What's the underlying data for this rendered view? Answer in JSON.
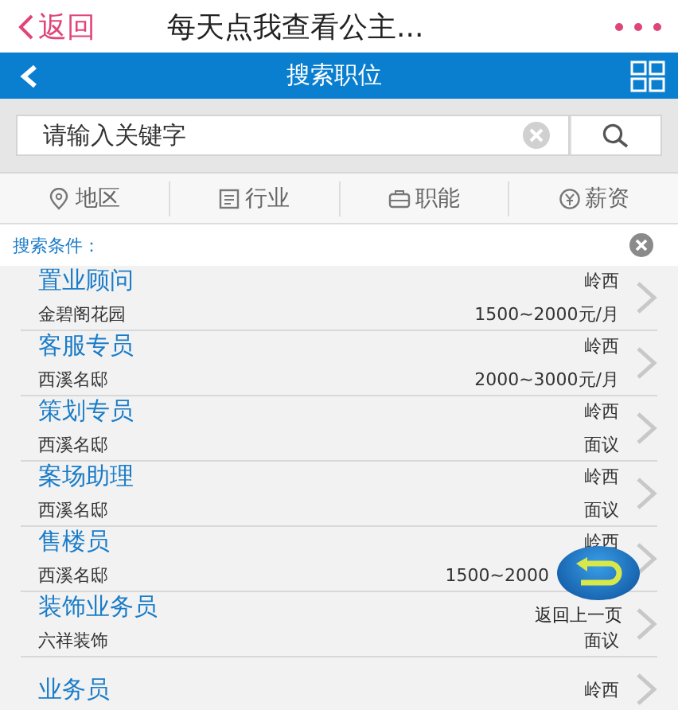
{
  "top_bar": {
    "back": "返回",
    "title": "每天点我查看公主..."
  },
  "nav_bar": {
    "title": "搜索职位"
  },
  "search": {
    "placeholder": "请输入关键字"
  },
  "filters": [
    {
      "label": "地区",
      "kind": "pin"
    },
    {
      "label": "行业",
      "kind": "doc"
    },
    {
      "label": "职能",
      "kind": "bag"
    },
    {
      "label": "薪资",
      "kind": "yen"
    }
  ],
  "conditions": {
    "label": "搜索条件："
  },
  "jobs": [
    {
      "title": "置业顾问",
      "company": "金碧阁花园",
      "location": "岭西",
      "salary": "1500~2000元/月"
    },
    {
      "title": "客服专员",
      "company": "西溪名邸",
      "location": "岭西",
      "salary": "2000~3000元/月"
    },
    {
      "title": "策划专员",
      "company": "西溪名邸",
      "location": "岭西",
      "salary": "面议"
    },
    {
      "title": "案场助理",
      "company": "西溪名邸",
      "location": "岭西",
      "salary": "面议"
    },
    {
      "title": "售楼员",
      "company": "西溪名邸",
      "location": "岭西",
      "salary": "1500~2000"
    },
    {
      "title": "装饰业务员",
      "company": "六祥装饰",
      "salary": "面议"
    },
    {
      "title": "业务员",
      "location": "岭西"
    }
  ],
  "float_button": {
    "label": "返回上一页"
  }
}
